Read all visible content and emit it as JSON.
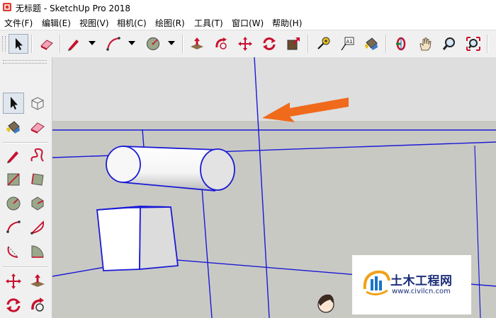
{
  "window": {
    "title": "无标题 - SketchUp Pro 2018"
  },
  "menu": [
    {
      "id": "file",
      "label": "文件(F)"
    },
    {
      "id": "edit",
      "label": "编辑(E)"
    },
    {
      "id": "view",
      "label": "视图(V)"
    },
    {
      "id": "camera",
      "label": "相机(C)"
    },
    {
      "id": "draw",
      "label": "绘图(R)"
    },
    {
      "id": "tools",
      "label": "工具(T)"
    },
    {
      "id": "window",
      "label": "窗口(W)"
    },
    {
      "id": "help",
      "label": "帮助(H)"
    }
  ],
  "toolbar_icons": [
    "select-icon",
    "eraser-icon",
    "pencil-icon",
    "arc-icon",
    "circle-icon",
    "push-pull-icon",
    "follow-me-icon",
    "move-icon",
    "rotate-icon",
    "scale-icon",
    "tape-measure-icon",
    "text-icon",
    "paint-bucket-icon",
    "orbit-icon",
    "pan-icon",
    "zoom-icon",
    "zoom-extents-icon"
  ],
  "toolbar": {
    "text_tool_label": "A1"
  },
  "sidebar_icons": [
    "select-icon",
    "component-icon",
    "paint-bucket-icon",
    "eraser-icon",
    "line-icon",
    "freehand-icon",
    "rectangle-icon",
    "rotated-rectangle-icon",
    "circle-icon",
    "polygon-icon",
    "arc-icon",
    "arc-2-icon",
    "arc-3-icon",
    "pie-icon",
    "move-icon",
    "push-pull-icon",
    "rotate-icon",
    "follow-me-icon"
  ],
  "watermark": {
    "name": "土木工程网",
    "url": "www.civilcn.com"
  },
  "colors": {
    "axis": "#1a1ad6",
    "arrow": "#f06a1c",
    "sky": "#dedede",
    "ground": "#c9c9c4",
    "accent_red": "#c8102e"
  }
}
